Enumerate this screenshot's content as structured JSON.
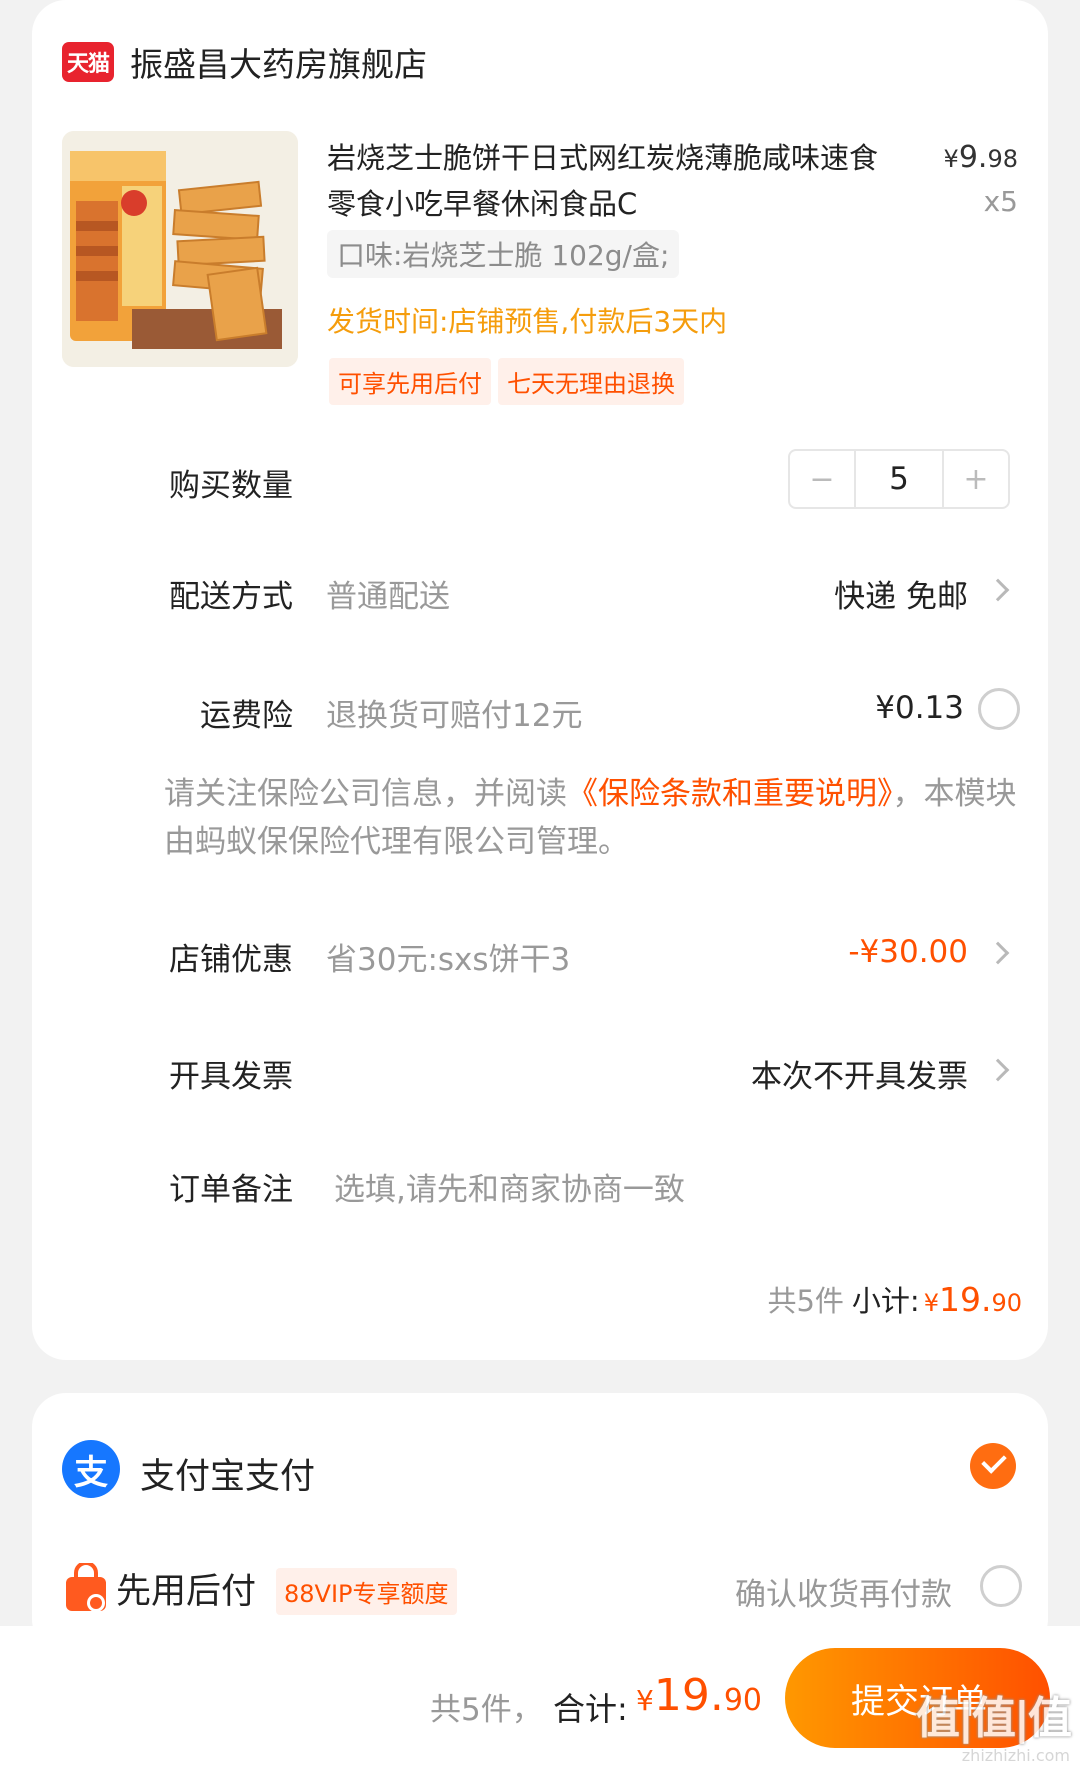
{
  "shop": {
    "badge": "天猫",
    "name": "振盛昌大药房旗舰店"
  },
  "product": {
    "title": "岩烧芝士脆饼干日式网红炭烧薄脆咸味速食零食小吃早餐休闲食品C",
    "price_currency": "¥",
    "price_int": "9.",
    "price_dec": "98",
    "qty_mult": "x5",
    "spec": "口味:岩烧芝士脆 102g/盒;",
    "ship_time": "发货时间:店铺预售,付款后3天内",
    "tags": [
      "可享先用后付",
      "七天无理由退换"
    ],
    "image_icon": "cracker-box-image"
  },
  "quantity": {
    "label": "购买数量",
    "value": "5",
    "minus": "−",
    "plus": "+"
  },
  "delivery": {
    "label": "配送方式",
    "sub": "普通配送",
    "value": "快递 免邮"
  },
  "insurance": {
    "label": "运费险",
    "sub": "退换货可赔付12元",
    "price": "¥0.13"
  },
  "notice": {
    "prefix": "请关注保险公司信息，并阅读",
    "link": "《保险条款和重要说明》",
    "suffix": "，本模块由蚂蚁保保险代理有限公司管理。"
  },
  "discount": {
    "label": "店铺优惠",
    "sub": "省30元:sxs饼干3",
    "value": "-¥30.00"
  },
  "invoice": {
    "label": "开具发票",
    "value": "本次不开具发票"
  },
  "remark": {
    "label": "订单备注",
    "placeholder": "选填,请先和商家协商一致"
  },
  "subtotal": {
    "count": "共5件",
    "label": "小计:",
    "currency": "¥",
    "int": "19.",
    "dec": "90"
  },
  "payment": {
    "alipay": {
      "icon_char": "支",
      "label": "支付宝支付",
      "selected": true
    },
    "pay_later": {
      "label": "先用后付",
      "tag": "88VIP专享额度",
      "note": "确认收货再付款",
      "selected": false
    }
  },
  "footer": {
    "count": "共5件，",
    "total_label": "合计:",
    "currency": "¥",
    "int": "19.",
    "dec": "90",
    "submit": "提交订单"
  },
  "watermark": {
    "main": "值|值|值",
    "sub": "zhizhizhi.com"
  },
  "colors": {
    "accent": "#ff5000",
    "alipay_blue": "#1677ff",
    "tmall_red": "#e8232e",
    "ship_time": "#f59d0d"
  }
}
